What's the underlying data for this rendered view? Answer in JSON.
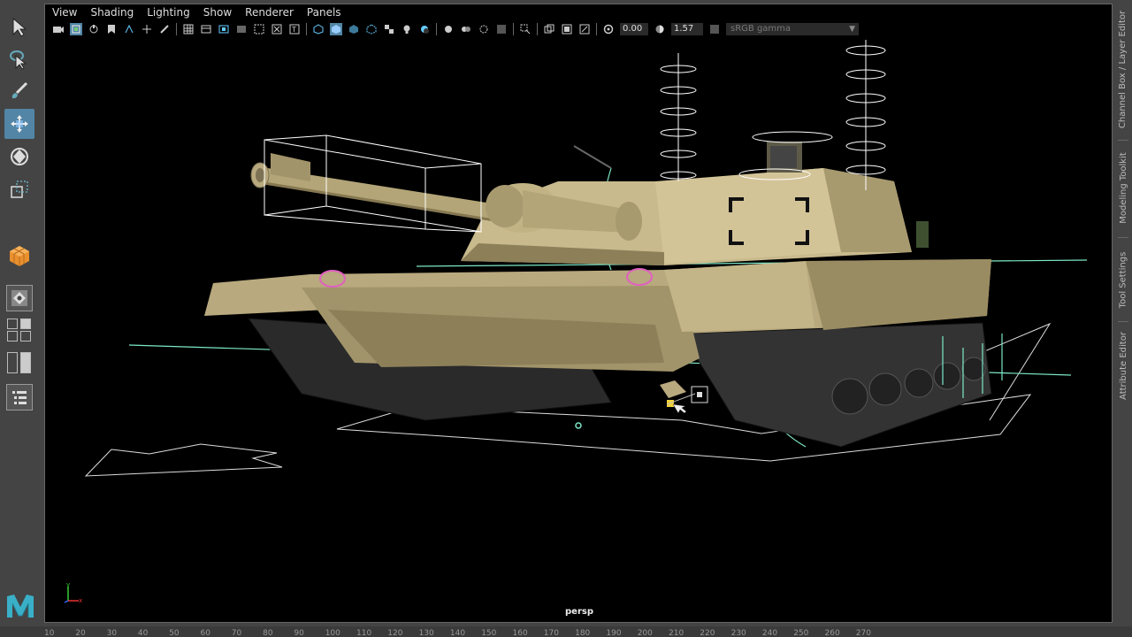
{
  "viewport": {
    "menu": [
      "View",
      "Shading",
      "Lighting",
      "Show",
      "Renderer",
      "Panels"
    ],
    "exposure_value": "0.00",
    "gamma_value": "1.57",
    "color_space": "sRGB gamma",
    "camera_label": "persp"
  },
  "side_tabs": [
    "Channel Box / Layer Editor",
    "Modeling Toolkit",
    "Tool Settings",
    "Attribute Editor"
  ],
  "timeline_ticks": [
    "10",
    "20",
    "30",
    "40",
    "50",
    "60",
    "70",
    "80",
    "90",
    "100",
    "110",
    "120",
    "130",
    "140",
    "150",
    "160",
    "170",
    "180",
    "190",
    "200",
    "210",
    "220",
    "230",
    "240",
    "250",
    "260",
    "270"
  ],
  "axis": {
    "x": "x",
    "y": "y"
  },
  "colors": {
    "accent": "#5285a6",
    "tank_body": "#b8a97e",
    "tank_shadow": "#7d7254",
    "wireframe": "#ffffff",
    "curve": "#7de8c8",
    "selection": "#e060c0"
  }
}
